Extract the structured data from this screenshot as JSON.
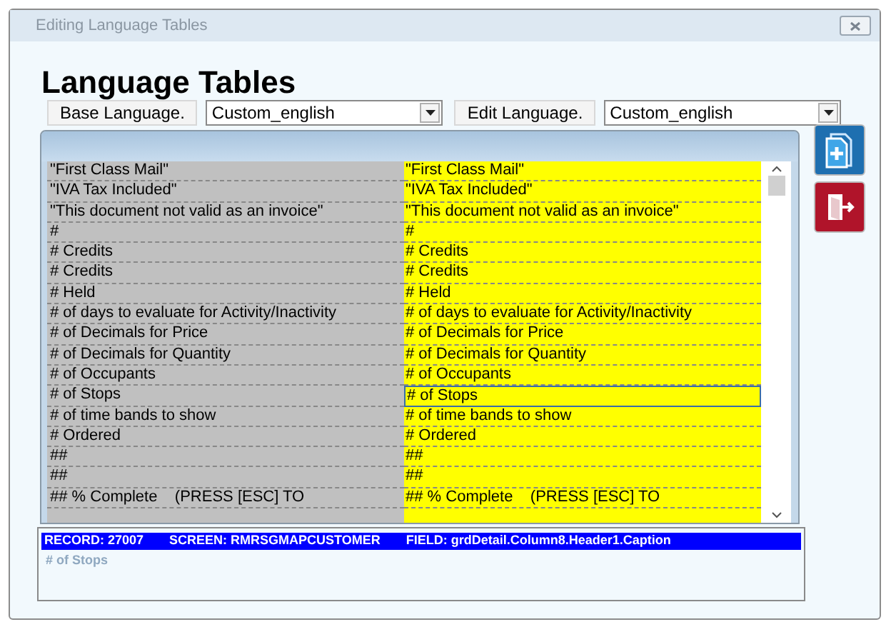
{
  "window": {
    "title": "Editing Language Tables"
  },
  "heading": "Language Tables",
  "base_language": {
    "label": "Base Language.",
    "value": "Custom_english"
  },
  "edit_language": {
    "label": "Edit Language.",
    "value": "Custom_english"
  },
  "rows": [
    {
      "base": "\"First Class Mail\"",
      "edit": "\"First Class Mail\"",
      "selected": false
    },
    {
      "base": "\"IVA Tax Included\"",
      "edit": "\"IVA Tax Included\"",
      "selected": false
    },
    {
      "base": "\"This document not valid as an invoice\"",
      "edit": "\"This document not valid as an invoice\"",
      "selected": false
    },
    {
      "base": "#",
      "edit": "#",
      "selected": false
    },
    {
      "base": "# Credits",
      "edit": "# Credits",
      "selected": false
    },
    {
      "base": "# Credits",
      "edit": "# Credits",
      "selected": false
    },
    {
      "base": "# Held",
      "edit": "# Held",
      "selected": false
    },
    {
      "base": "# of days to evaluate for Activity/Inactivity",
      "edit": "# of days to evaluate for Activity/Inactivity",
      "selected": false
    },
    {
      "base": "# of Decimals for Price",
      "edit": "# of Decimals for Price",
      "selected": false
    },
    {
      "base": "# of Decimals for Quantity",
      "edit": "# of Decimals for Quantity",
      "selected": false
    },
    {
      "base": "# of Occupants",
      "edit": "# of Occupants",
      "selected": false
    },
    {
      "base": "# of Stops",
      "edit": "# of Stops",
      "selected": true
    },
    {
      "base": "# of time bands to show",
      "edit": "# of time bands to show",
      "selected": false
    },
    {
      "base": "# Ordered",
      "edit": "# Ordered",
      "selected": false
    },
    {
      "base": "##",
      "edit": "##",
      "selected": false
    },
    {
      "base": "##",
      "edit": "##",
      "selected": false
    },
    {
      "base": "## % Complete    (PRESS [ESC] TO",
      "edit": "## % Complete    (PRESS [ESC] TO",
      "selected": false
    }
  ],
  "status_bar": {
    "record": "RECORD: 27007",
    "screen": "SCREEN: RMRSGMAPCUSTOMER",
    "field": "FIELD: grdDetail.Column8.Header1.Caption"
  },
  "current_value": "# of Stops"
}
